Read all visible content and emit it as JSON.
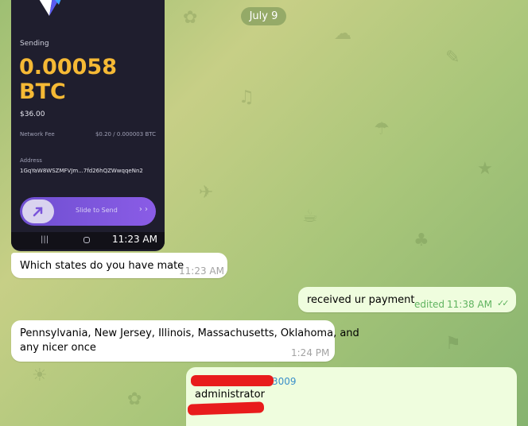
{
  "chat": {
    "date_label": "July 9"
  },
  "screenshot": {
    "sending_label": "Sending",
    "amount": "0.00058",
    "unit": "BTC",
    "usd_value": "$36.00",
    "network_fee_label": "Network Fee",
    "network_fee_value": "$0.20 / 0.000003 BTC",
    "address_label": "Address",
    "address_value": "1GqYaW8WSZMFVJm...7fd26hQZWwqqeNn2",
    "slide_label": "Slide to Send",
    "slide_arrows": "› ›",
    "nav_time": "11:23 AM",
    "nav_menu_glyph": "|||",
    "colors": {
      "amount": "#f5b935",
      "slider": "#7a55da",
      "bg": "#1f1e2e"
    }
  },
  "messages": [
    {
      "side": "in",
      "text": "Which states do you have mate",
      "time": "11:23 AM"
    },
    {
      "side": "out",
      "text": "received ur payment",
      "status": "edited",
      "time": "11:38 AM",
      "ticks": "✓✓"
    },
    {
      "side": "in",
      "text_line1": "Pennsylvania, New Jersey, Illinois, Massachusetts, Oklahoma, and",
      "text_line2": "any nicer once",
      "time": "1:24 PM"
    },
    {
      "side": "out",
      "partial_number": "3009",
      "text": "administrator"
    }
  ],
  "colors": {
    "incoming_bubble": "#ffffff",
    "outgoing_bubble": "#effdde",
    "outgoing_time": "#5fb35f",
    "redaction": "#e81c1c"
  }
}
